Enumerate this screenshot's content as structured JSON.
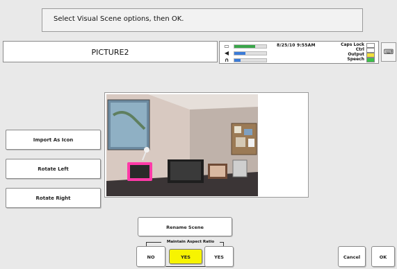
{
  "prompt": {
    "text": "Select Visual Scene options, then OK."
  },
  "title": {
    "text": "PICTURE2"
  },
  "status": {
    "datetime": "8/25/10 9:55AM",
    "caps_lock_label": "Caps Lock",
    "ctrl_label": "Ctrl",
    "output_label": "Output",
    "speech_label": "Speech",
    "battery_level": 0.65,
    "volume_level": 0.35,
    "headphone_level": 0.2,
    "colors": {
      "battery": "#3aa64a",
      "volume": "#3b7bd8",
      "headphone": "#3b7bd8",
      "output_led": "#f2e03c",
      "speech_led": "#3cc24a"
    }
  },
  "side_buttons": {
    "import": "Import As Icon",
    "rotate_left": "Rotate Left",
    "rotate_right": "Rotate Right"
  },
  "rename_button": "Rename Scene",
  "aspect": {
    "legend": "Maintain Aspect Ratio",
    "no": "NO",
    "yes_selected": "YES",
    "yes": "YES",
    "selected_color": "#f7f400"
  },
  "actions": {
    "cancel": "Cancel",
    "ok": "OK"
  },
  "icons": {
    "battery": "battery-icon",
    "volume": "speaker-icon",
    "headphone": "headphones-icon",
    "keyboard": "keyboard-icon"
  }
}
